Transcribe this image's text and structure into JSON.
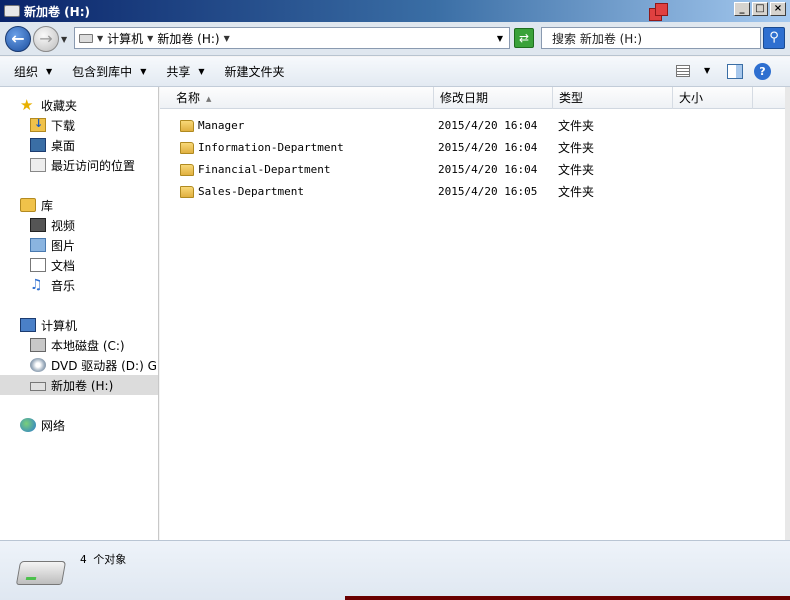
{
  "window": {
    "title": "新加卷 (H:)"
  },
  "address": {
    "crumbs": [
      "计算机",
      "新加卷 (H:)"
    ],
    "search_placeholder": "搜索 新加卷 (H:)"
  },
  "toolbar": {
    "organize": "组织",
    "include_library": "包含到库中",
    "share": "共享",
    "new_folder": "新建文件夹"
  },
  "nav": {
    "favorites": {
      "label": "收藏夹",
      "items": [
        "下载",
        "桌面",
        "最近访问的位置"
      ]
    },
    "libraries": {
      "label": "库",
      "items": [
        "视频",
        "图片",
        "文档",
        "音乐"
      ]
    },
    "computer": {
      "label": "计算机",
      "items": [
        "本地磁盘 (C:)",
        "DVD 驱动器 (D:) GR",
        "新加卷 (H:)"
      ]
    },
    "network": {
      "label": "网络"
    }
  },
  "columns": [
    "名称",
    "修改日期",
    "类型",
    "大小"
  ],
  "files": [
    {
      "name": "Manager",
      "date": "2015/4/20 16:04",
      "type": "文件夹"
    },
    {
      "name": "Information-Department",
      "date": "2015/4/20 16:04",
      "type": "文件夹"
    },
    {
      "name": "Financial-Department",
      "date": "2015/4/20 16:04",
      "type": "文件夹"
    },
    {
      "name": "Sales-Department",
      "date": "2015/4/20 16:05",
      "type": "文件夹"
    }
  ],
  "details": {
    "count_text": "4 个对象"
  }
}
